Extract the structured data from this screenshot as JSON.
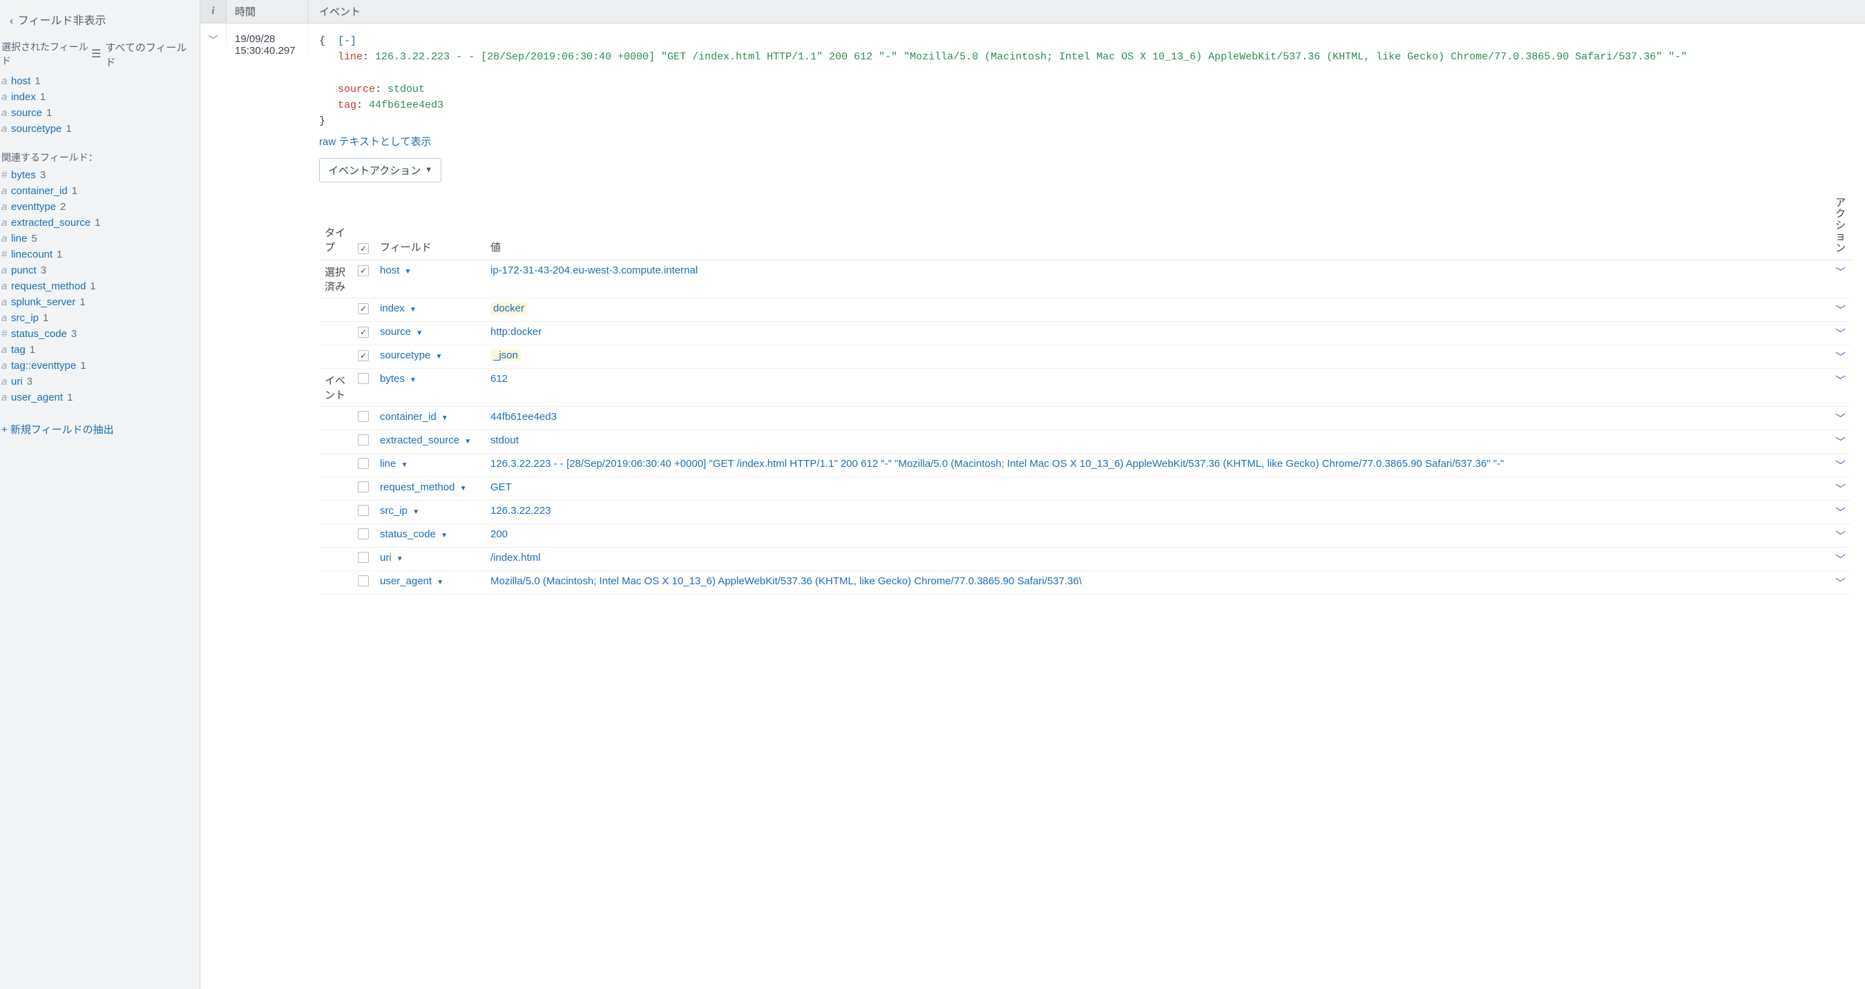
{
  "sidebar": {
    "hide_fields": "フィールド非表示",
    "selected_label": "選択されたフィールド",
    "all_fields_label": "すべてのフィールド",
    "related_label": "関連するフィールド：",
    "extract_label": "+ 新規フィールドの抽出",
    "selected_fields": [
      {
        "type": "a",
        "name": "host",
        "count": 1
      },
      {
        "type": "a",
        "name": "index",
        "count": 1
      },
      {
        "type": "a",
        "name": "source",
        "count": 1
      },
      {
        "type": "a",
        "name": "sourcetype",
        "count": 1
      }
    ],
    "related_fields": [
      {
        "type": "#",
        "name": "bytes",
        "count": 3
      },
      {
        "type": "a",
        "name": "container_id",
        "count": 1
      },
      {
        "type": "a",
        "name": "eventtype",
        "count": 2
      },
      {
        "type": "a",
        "name": "extracted_source",
        "count": 1
      },
      {
        "type": "a",
        "name": "line",
        "count": 5
      },
      {
        "type": "#",
        "name": "linecount",
        "count": 1
      },
      {
        "type": "a",
        "name": "punct",
        "count": 3
      },
      {
        "type": "a",
        "name": "request_method",
        "count": 1
      },
      {
        "type": "a",
        "name": "splunk_server",
        "count": 1
      },
      {
        "type": "a",
        "name": "src_ip",
        "count": 1
      },
      {
        "type": "#",
        "name": "status_code",
        "count": 3
      },
      {
        "type": "a",
        "name": "tag",
        "count": 1
      },
      {
        "type": "a",
        "name": "tag::eventtype",
        "count": 1
      },
      {
        "type": "a",
        "name": "uri",
        "count": 3
      },
      {
        "type": "a",
        "name": "user_agent",
        "count": 1
      }
    ]
  },
  "columns": {
    "info": "i",
    "time": "時間",
    "event": "イベント"
  },
  "event": {
    "date": "19/09/28",
    "time": "15:30:40.297",
    "json": {
      "collapse": "[-]",
      "line_key": "line",
      "line_val": "126.3.22.223 - - [28/Sep/2019:06:30:40 +0000] \"GET /index.html HTTP/1.1\" 200 612 \"-\" \"Mozilla/5.0 (Macintosh; Intel Mac OS X 10_13_6) AppleWebKit/537.36 (KHTML, like Gecko) Chrome/77.0.3865.90 Safari/537.36\" \"-\"",
      "source_key": "source",
      "source_val": "stdout",
      "tag_key": "tag",
      "tag_val": "44fb61ee4ed3"
    },
    "raw_link": "raw テキストとして表示",
    "actions_label": "イベントアクション"
  },
  "ftable": {
    "headers": {
      "type": "タイプ",
      "field": "フィールド",
      "value": "値",
      "action": "アクション"
    },
    "group_selected": "選択済み",
    "group_event": "イベント",
    "rows": [
      {
        "group": "selected",
        "checked": true,
        "name": "host",
        "value": "ip-172-31-43-204.eu-west-3.compute.internal",
        "hl": false
      },
      {
        "group": "selected",
        "checked": true,
        "name": "index",
        "value": "docker",
        "hl": true
      },
      {
        "group": "selected",
        "checked": true,
        "name": "source",
        "value": "http:docker",
        "hl": false
      },
      {
        "group": "selected",
        "checked": true,
        "name": "sourcetype",
        "value": "_json",
        "hl": true
      },
      {
        "group": "event",
        "checked": false,
        "name": "bytes",
        "value": "612",
        "hl": false
      },
      {
        "group": "event",
        "checked": false,
        "name": "container_id",
        "value": "44fb61ee4ed3",
        "hl": false
      },
      {
        "group": "event",
        "checked": false,
        "name": "extracted_source",
        "value": "stdout",
        "hl": false
      },
      {
        "group": "event",
        "checked": false,
        "name": "line",
        "value": "126.3.22.223 - - [28/Sep/2019:06:30:40 +0000] \"GET /index.html HTTP/1.1\" 200 612 \"-\" \"Mozilla/5.0 (Macintosh; Intel Mac OS X 10_13_6) AppleWebKit/537.36 (KHTML, like Gecko) Chrome/77.0.3865.90 Safari/537.36\" \"-\"",
        "hl": false
      },
      {
        "group": "event",
        "checked": false,
        "name": "request_method",
        "value": "GET",
        "hl": false
      },
      {
        "group": "event",
        "checked": false,
        "name": "src_ip",
        "value": "126.3.22.223",
        "hl": false
      },
      {
        "group": "event",
        "checked": false,
        "name": "status_code",
        "value": "200",
        "hl": false
      },
      {
        "group": "event",
        "checked": false,
        "name": "uri",
        "value": "/index.html",
        "hl": false
      },
      {
        "group": "event",
        "checked": false,
        "name": "user_agent",
        "value": "Mozilla/5.0 (Macintosh; Intel Mac OS X 10_13_6) AppleWebKit/537.36 (KHTML, like Gecko) Chrome/77.0.3865.90 Safari/537.36\\",
        "hl": false
      }
    ]
  }
}
